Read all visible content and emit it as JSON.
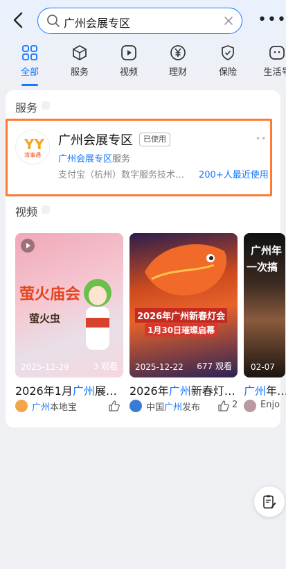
{
  "search": {
    "query": "广州会展专区"
  },
  "tabs": [
    {
      "label": "全部",
      "icon": "grid-icon",
      "active": true
    },
    {
      "label": "服务",
      "icon": "cube-icon"
    },
    {
      "label": "视频",
      "icon": "play-icon"
    },
    {
      "label": "理财",
      "icon": "yen-icon"
    },
    {
      "label": "保险",
      "icon": "shield-icon"
    },
    {
      "label": "生活号",
      "icon": "face-icon"
    }
  ],
  "services_section": {
    "title": "服务"
  },
  "service": {
    "logo_text": "湾事通",
    "name": "广州会展专区",
    "badge": "已使用",
    "sub_highlight": "广州会展专区",
    "sub_suffix": "服务",
    "company": "支付宝（杭州）数字服务技术…",
    "users": "200+人最近使用"
  },
  "videos_section": {
    "title": "视频"
  },
  "videos": [
    {
      "cover_line1": "萤火庙会",
      "cover_line2": "萤火虫",
      "date": "2025-12-29",
      "views": "3 观看",
      "title_prefix": "2026年1月",
      "title_highlight": "广州",
      "title_suffix": "展…",
      "source_highlight": "广州",
      "source_suffix": "本地宝",
      "likes": ""
    },
    {
      "cover_line1": "2026年广州新春灯会",
      "cover_line2": "1月30日璀璨启幕",
      "date": "2025-12-22",
      "views": "677 观看",
      "title_prefix": "2026年",
      "title_highlight": "广州",
      "title_suffix": "新春灯…",
      "source_prefix": "中国",
      "source_highlight": "广州",
      "source_suffix": "发布",
      "likes": "2"
    },
    {
      "cover_line1": "广州年",
      "cover_line2": "一次搞",
      "date": "02-07",
      "views": "",
      "title_highlight": "广州",
      "title_suffix": "年…",
      "source_prefix": "Enjo",
      "likes": ""
    }
  ],
  "colors": {
    "accent": "#1677ff",
    "highlight_border": "#ff7a33"
  }
}
